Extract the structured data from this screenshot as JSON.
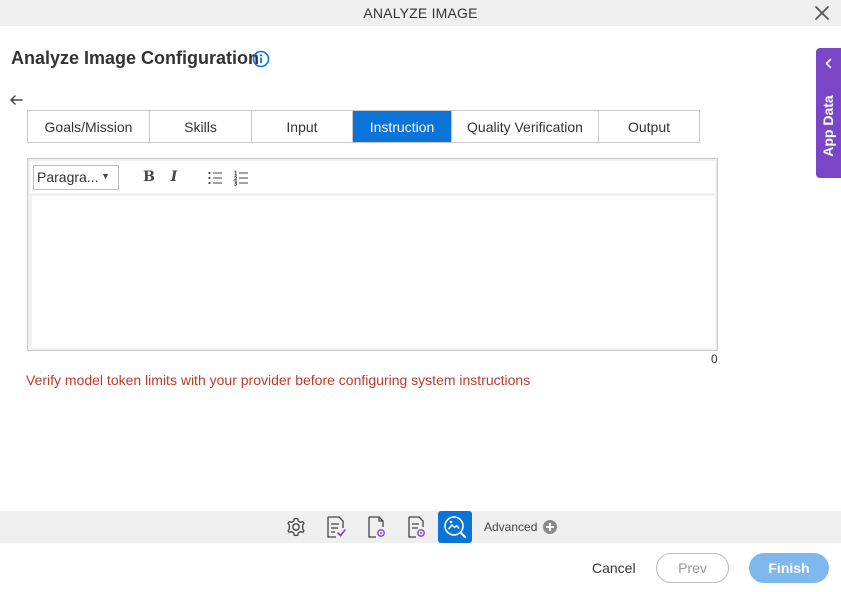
{
  "window": {
    "title": "ANALYZE IMAGE"
  },
  "page": {
    "title": "Analyze Image Configuration"
  },
  "tabs": [
    {
      "label": "Goals/Mission"
    },
    {
      "label": "Skills"
    },
    {
      "label": "Input"
    },
    {
      "label": "Instruction",
      "active": true
    },
    {
      "label": "Quality Verification"
    },
    {
      "label": "Output"
    }
  ],
  "editor": {
    "format_select": "Paragra...",
    "bold_label": "B",
    "italic_label": "I",
    "content": "",
    "char_count": "0"
  },
  "warning": "Verify model token limits with your provider before configuring system instructions",
  "side_panel": {
    "label": "App Data"
  },
  "bottom_toolbar": {
    "icons": [
      "settings-icon",
      "form-check-icon",
      "document-settings-icon",
      "form-settings-icon",
      "image-analyze-icon"
    ],
    "advanced_label": "Advanced"
  },
  "footer": {
    "cancel_label": "Cancel",
    "prev_label": "Prev",
    "finish_label": "Finish"
  },
  "colors": {
    "accent": "#0a74d9",
    "side_panel": "#7b45c8",
    "warning": "#c0392b",
    "finish_disabled": "#7fb8ec"
  }
}
